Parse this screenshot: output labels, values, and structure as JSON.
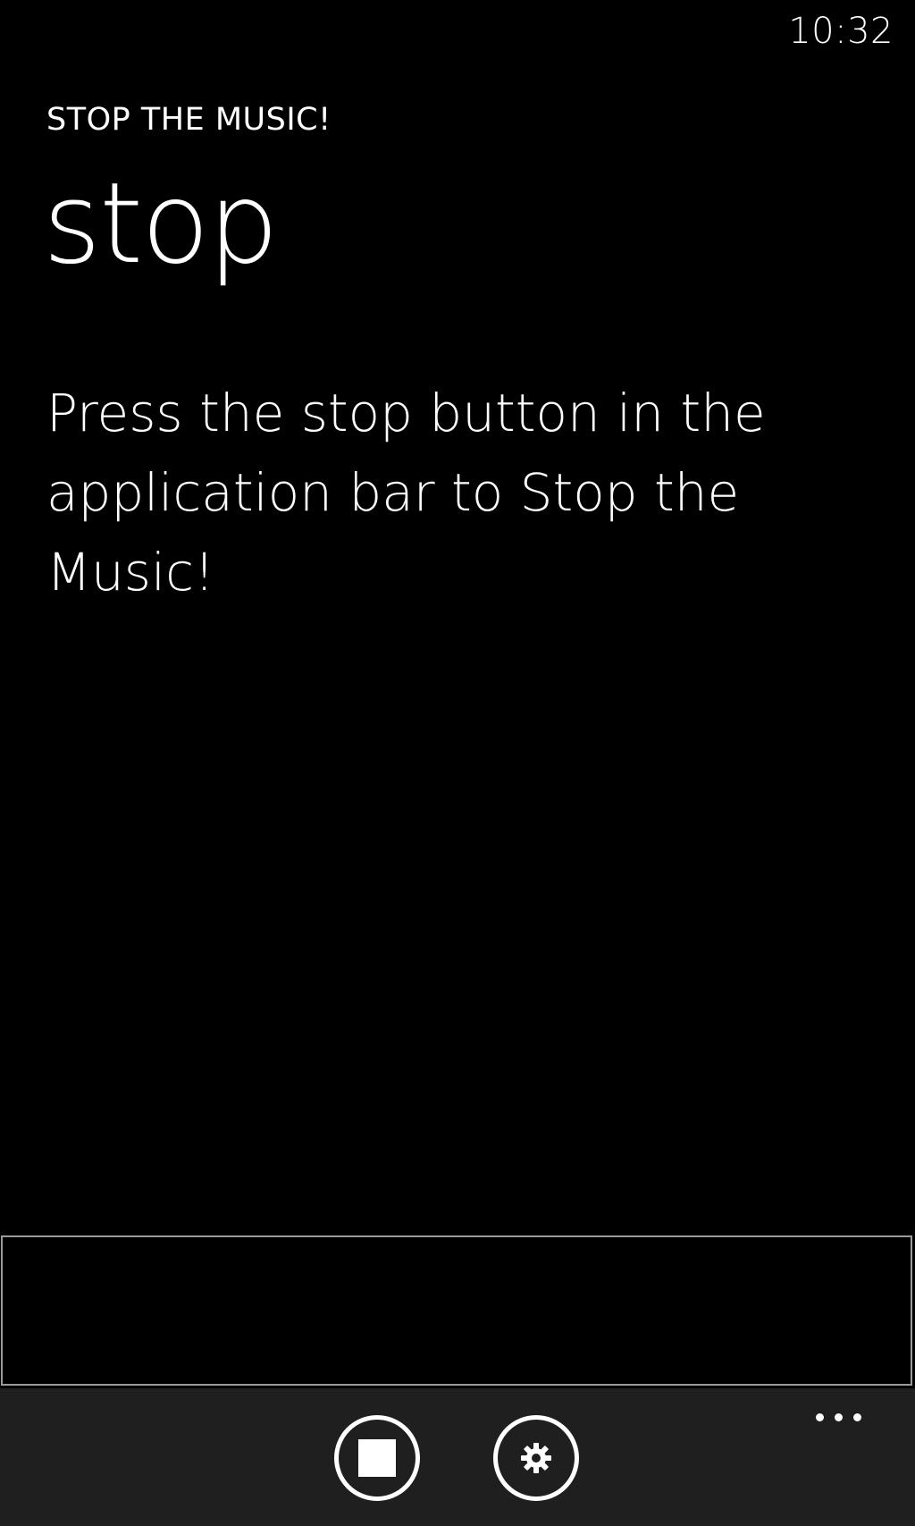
{
  "status_bar": {
    "time": "10:32"
  },
  "header": {
    "app_title": "STOP THE MUSIC!",
    "page_title": "stop"
  },
  "content": {
    "instructions": "Press the stop button in the application bar to Stop the Music!"
  },
  "app_bar": {
    "buttons": [
      {
        "icon": "stop-icon"
      },
      {
        "icon": "gear-icon"
      }
    ],
    "more_icon": "ellipsis-icon"
  },
  "colors": {
    "background": "#000000",
    "app_bar_background": "#1f1f1f",
    "foreground": "#ffffff",
    "ad_border": "#9a9a9a"
  }
}
